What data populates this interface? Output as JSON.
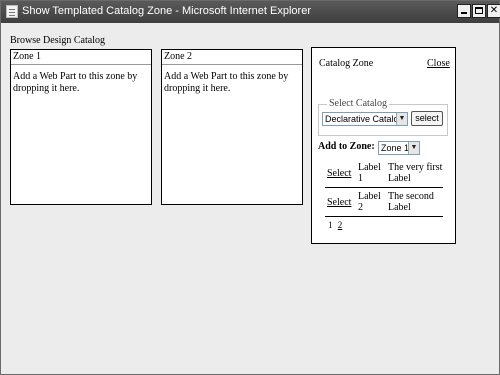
{
  "window": {
    "title": "Show Templated Catalog Zone - Microsoft Internet Explorer"
  },
  "page": {
    "browse_label": "Browse Design Catalog"
  },
  "zones": [
    {
      "header": "Zone 1",
      "body": "Add a Web Part to this zone by dropping it here."
    },
    {
      "header": "Zone 2",
      "body": "Add a Web Part to this zone by dropping it here."
    }
  ],
  "catalog_zone": {
    "title": "Catalog Zone",
    "close_label": "Close",
    "select_catalog_legend": "Select Catalog",
    "catalog_selected": "Declarative Catalog",
    "select_button": "select",
    "add_to_zone_label": "Add to Zone:",
    "zone_selected": "Zone 1",
    "parts": [
      {
        "select": "Select",
        "label": "Label 1",
        "description": "The very first Label"
      },
      {
        "select": "Select",
        "label": "Label 2",
        "description": "The second Label"
      }
    ],
    "pager": {
      "current": "1",
      "next": "2"
    }
  },
  "icons": {
    "window_icon": "ie-page-icon",
    "dropdown_arrow": "▼"
  }
}
